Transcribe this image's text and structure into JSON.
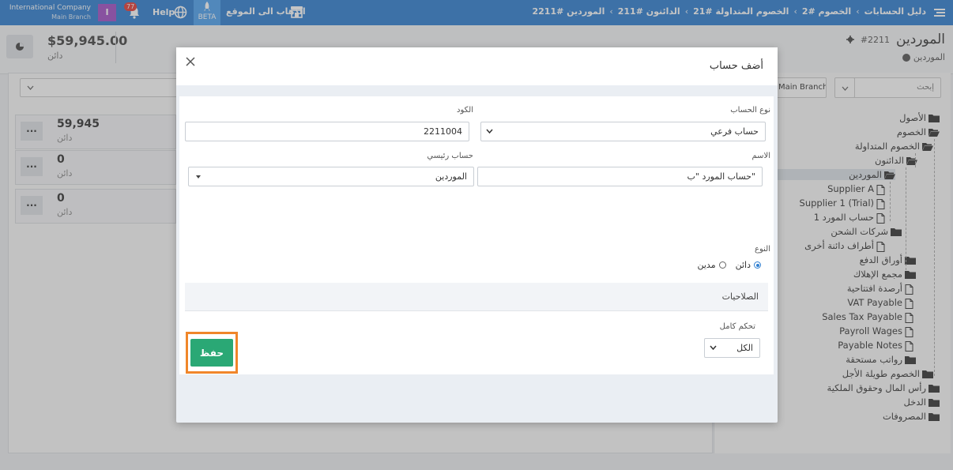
{
  "topbar": {
    "breadcrumbs": [
      "دليل الحسابات",
      "الخصوم #2",
      "الخصوم المتداولة #21",
      "الدائنون #211",
      "الموردين #2211"
    ],
    "separator": "‹",
    "goto_site": "الذهاب الى الموقع",
    "beta_label": "BETA",
    "help_label": "Help",
    "notifications_count": "77",
    "user_initial": "I",
    "company_name": "International Company",
    "company_branch": "Main Branch",
    "accent_color": "#2f7fd1"
  },
  "page_header": {
    "title": "الموردين",
    "code": "#2211",
    "subtitle": "الموردين",
    "amount": "$59,945.00",
    "amount_type": "دائن"
  },
  "left_panel": {
    "cards": [
      {
        "value": "59,945",
        "type": "دائن",
        "menu": "..."
      },
      {
        "value": "0",
        "type": "دائن",
        "menu": "..."
      },
      {
        "value": "0",
        "type": "دائن",
        "menu": "..."
      }
    ]
  },
  "right_panel": {
    "search_placeholder": "إبحث",
    "branch_label": "Main Branch",
    "tree": [
      {
        "label": "الأصول",
        "icon": "folder-icon"
      },
      {
        "label": "الخصوم",
        "icon": "folder-open-icon"
      },
      {
        "label": "الخصوم المتداولة",
        "icon": "folder-open-icon"
      },
      {
        "label": "الدائنون",
        "icon": "folder-open-icon"
      },
      {
        "label": "الموردين",
        "icon": "folder-open-icon"
      },
      {
        "label": "Supplier A",
        "icon": "file-icon"
      },
      {
        "label": "Supplier 1 (Trial)",
        "icon": "file-icon"
      },
      {
        "label": "حساب المورد 1",
        "icon": "file-icon"
      },
      {
        "label": "شركات الشحن",
        "icon": "folder-icon"
      },
      {
        "label": "أطراف دائنة أخرى",
        "icon": "file-icon"
      },
      {
        "label": "أوراق الدفع",
        "icon": "folder-icon"
      },
      {
        "label": "مجمع الإهلاك",
        "icon": "folder-icon"
      },
      {
        "label": "أرصدة افتتاحية",
        "icon": "file-icon"
      },
      {
        "label": "VAT Payable",
        "icon": "file-icon"
      },
      {
        "label": "Sales Tax Payable",
        "icon": "file-icon"
      },
      {
        "label": "Payroll Wages",
        "icon": "file-icon"
      },
      {
        "label": "Payable Notes",
        "icon": "file-icon"
      },
      {
        "label": "رواتب مستحقة",
        "icon": "folder-icon"
      },
      {
        "label": "الخصوم طويلة الأجل",
        "icon": "folder-icon"
      },
      {
        "label": "رأس المال وحقوق الملكية",
        "icon": "folder-icon"
      },
      {
        "label": "الدخل",
        "icon": "folder-icon"
      },
      {
        "label": "المصروفات",
        "icon": "folder-icon"
      }
    ]
  },
  "modal": {
    "title": "أضف حساب",
    "account_type_label": "نوع الحساب",
    "account_type_value": "حساب فرعي",
    "code_label": "الكود",
    "code_value": "2211004",
    "name_label": "الاسم",
    "name_value": "حساب المورد \"ب\"",
    "parent_label": "حساب رئيسي",
    "parent_value": "الموردين",
    "kind_label": "النوع",
    "kind_options": [
      "دائن",
      "مدين"
    ],
    "kind_selected": "دائن",
    "permissions_label": "الصلاحيات",
    "full_control_label": "تحكم كامل",
    "full_control_value": "الكل",
    "save_label": "حفظ",
    "save_color": "#2aa875",
    "highlight_color": "#f0862a"
  }
}
